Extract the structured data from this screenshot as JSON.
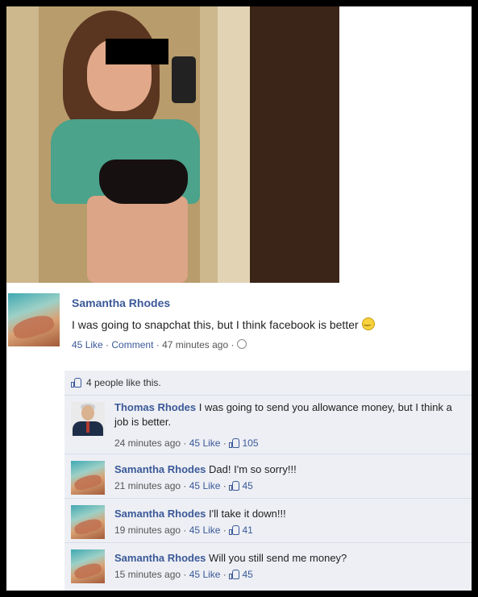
{
  "post": {
    "author": "Samantha Rhodes",
    "text": "I was going to snapchat this, but I think facebook is better",
    "like_count": "45",
    "like_label": "Like",
    "comment_label": "Comment",
    "time": "47 minutes ago",
    "likes_summary": "4 people like this."
  },
  "comments": [
    {
      "author": "Thomas Rhodes",
      "text": "I was going to send you allowance money, but I think a job is better.",
      "time": "24 minutes ago",
      "like_count": "45",
      "like_label": "Like",
      "thumbs": "105"
    },
    {
      "author": "Samantha Rhodes",
      "text": "Dad! I'm so sorry!!!",
      "time": "21 minutes ago",
      "like_count": "45",
      "like_label": "Like",
      "thumbs": "45"
    },
    {
      "author": "Samantha Rhodes",
      "text": "I'll take it down!!!",
      "time": "19 minutes ago",
      "like_count": "45",
      "like_label": "Like",
      "thumbs": "41"
    },
    {
      "author": "Samantha Rhodes",
      "text": "Will you still send me money?",
      "time": "15 minutes ago",
      "like_count": "45",
      "like_label": "Like",
      "thumbs": "45"
    }
  ],
  "colors": {
    "link": "#3b5998",
    "comments_bg": "#edeff4"
  }
}
